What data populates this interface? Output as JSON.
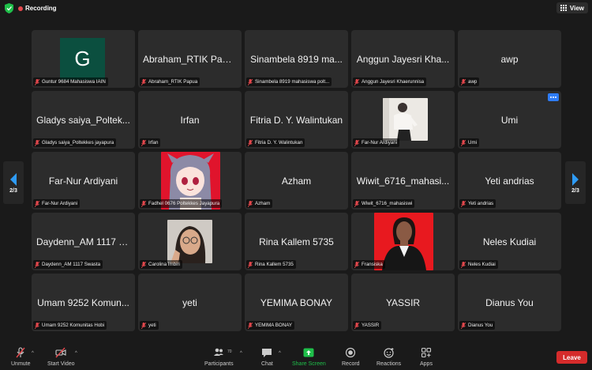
{
  "topbar": {
    "recording_label": "Recording",
    "view_label": "View"
  },
  "pager": {
    "left_label": "2/3",
    "right_label": "2/3"
  },
  "tiles": [
    {
      "display": "",
      "label": "Guntur 9684 Mahasiswa IAIN",
      "avatar_letter": "G"
    },
    {
      "display": "Abraham_RTIK Papua",
      "label": "Abraham_RTIK Papua"
    },
    {
      "display": "Sinambela 8919 ma...",
      "label": "Sinambela 8919 mahasiswa polt..."
    },
    {
      "display": "Anggun Jayesri Kha...",
      "label": "Anggun Jayesri Khaerunnisa"
    },
    {
      "display": "awp",
      "label": "awp"
    },
    {
      "display": "Gladys saiya_Poltek...",
      "label": "Gladys saiya_Poltekkes jayapura"
    },
    {
      "display": "Irfan",
      "label": "Irfan"
    },
    {
      "display": "Fitria D. Y.  Walintukan",
      "label": "Fitria D. Y.  Walintukan"
    },
    {
      "display": "",
      "label": "Far-Nur Ardiyani"
    },
    {
      "display": "Umi",
      "label": "Umi"
    },
    {
      "display": "Far-Nur Ardiyani",
      "label": "Far-Nur Ardiyani"
    },
    {
      "display": "",
      "label": "Fadhel 0676 Poltekkes Jayapura"
    },
    {
      "display": "Azham",
      "label": "Azham"
    },
    {
      "display": "Wiwit_6716_mahasi...",
      "label": "Wiwit_6716_mahasiswi"
    },
    {
      "display": "Yeti andrias",
      "label": "Yeti andrias"
    },
    {
      "display": "Daydenn_AM 1117 S...",
      "label": "Daydenn_AM 1117 Swasta"
    },
    {
      "display": "",
      "label": "Carolina Imbiri"
    },
    {
      "display": "Rina Kallem 5735",
      "label": "Rina Kallem 5735"
    },
    {
      "display": "",
      "label": "Fransiska"
    },
    {
      "display": "Neles Kudiai",
      "label": "Neles Kudiai"
    },
    {
      "display": "Umam 9252 Komun...",
      "label": "Umam 9252 Komunitas Hobi"
    },
    {
      "display": "yeti",
      "label": "yeti"
    },
    {
      "display": "YEMIMA BONAY",
      "label": "YEMIMA BONAY"
    },
    {
      "display": "YASSIR",
      "label": "YASSIR"
    },
    {
      "display": "Dianus You",
      "label": "Dianus You"
    }
  ],
  "toolbar": {
    "unmute": "Unmute",
    "start_video": "Start Video",
    "participants": "Participants",
    "participants_count": "70",
    "chat": "Chat",
    "share_screen": "Share Screen",
    "record": "Record",
    "reactions": "Reactions",
    "apps": "Apps",
    "leave": "Leave"
  },
  "colors": {
    "share_green": "#1fbf4a",
    "leave_red": "#d52b2b",
    "accent_blue": "#2e7cf6",
    "recording_red": "#e5484d"
  }
}
